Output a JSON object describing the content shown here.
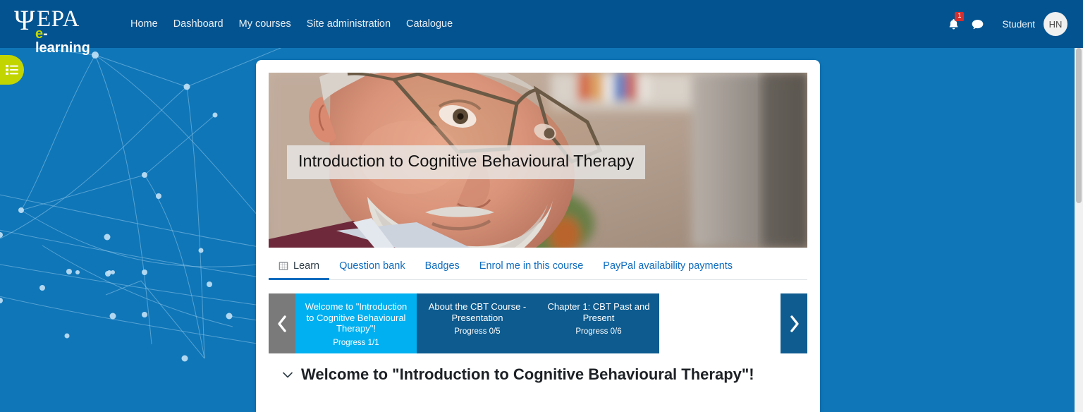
{
  "navbar": {
    "logo": {
      "psi": "Ψ",
      "epa": "EPA",
      "sub_e": "e",
      "sub_rest": "-learning"
    },
    "links": [
      {
        "label": "Home",
        "name": "nav-home"
      },
      {
        "label": "Dashboard",
        "name": "nav-dashboard"
      },
      {
        "label": "My courses",
        "name": "nav-my-courses"
      },
      {
        "label": "Site administration",
        "name": "nav-site-administration"
      },
      {
        "label": "Catalogue",
        "name": "nav-catalogue"
      }
    ],
    "notifications": {
      "icon": "bell-icon",
      "count": "1"
    },
    "messages": {
      "icon": "message-icon"
    },
    "user": {
      "role_label": "Student",
      "avatar_initials": "HN"
    }
  },
  "drawer_toggle": {
    "icon": "list-menu-icon"
  },
  "course": {
    "hero_title": "Introduction to Cognitive Behavioural Therapy",
    "tabs": [
      {
        "label": "Learn",
        "icon": "grid-icon",
        "active": true
      },
      {
        "label": "Question bank",
        "active": false
      },
      {
        "label": "Badges",
        "active": false
      },
      {
        "label": "Enrol me in this course",
        "active": false
      },
      {
        "label": "PayPal availability payments",
        "active": false
      }
    ],
    "carousel": {
      "prev_icon": "chevron-left-icon",
      "next_icon": "chevron-right-icon",
      "tiles": [
        {
          "title": "Welcome to \"Introduction to Cognitive Behavioural Therapy\"!",
          "progress": "Progress 1/1",
          "active": true
        },
        {
          "title": "About the CBT Course - Presentation",
          "progress": "Progress 0/5",
          "active": false
        },
        {
          "title": "Chapter 1: CBT Past and Present",
          "progress": "Progress 0/6",
          "active": false
        }
      ]
    },
    "section": {
      "collapse_icon": "chevron-down-icon",
      "title": "Welcome to \"Introduction to Cognitive Behavioural Therapy\"!"
    }
  },
  "colors": {
    "navbar_bg": "#025390",
    "page_bg": "#0f76b8",
    "brand_accent": "#c2d500",
    "link_blue": "#0f6cbf",
    "tile_active": "#00b0f0",
    "tile_inactive": "#0d5b8f",
    "arrow_prev_bg": "#7a7a7a",
    "badge_red": "#d32f2f"
  }
}
